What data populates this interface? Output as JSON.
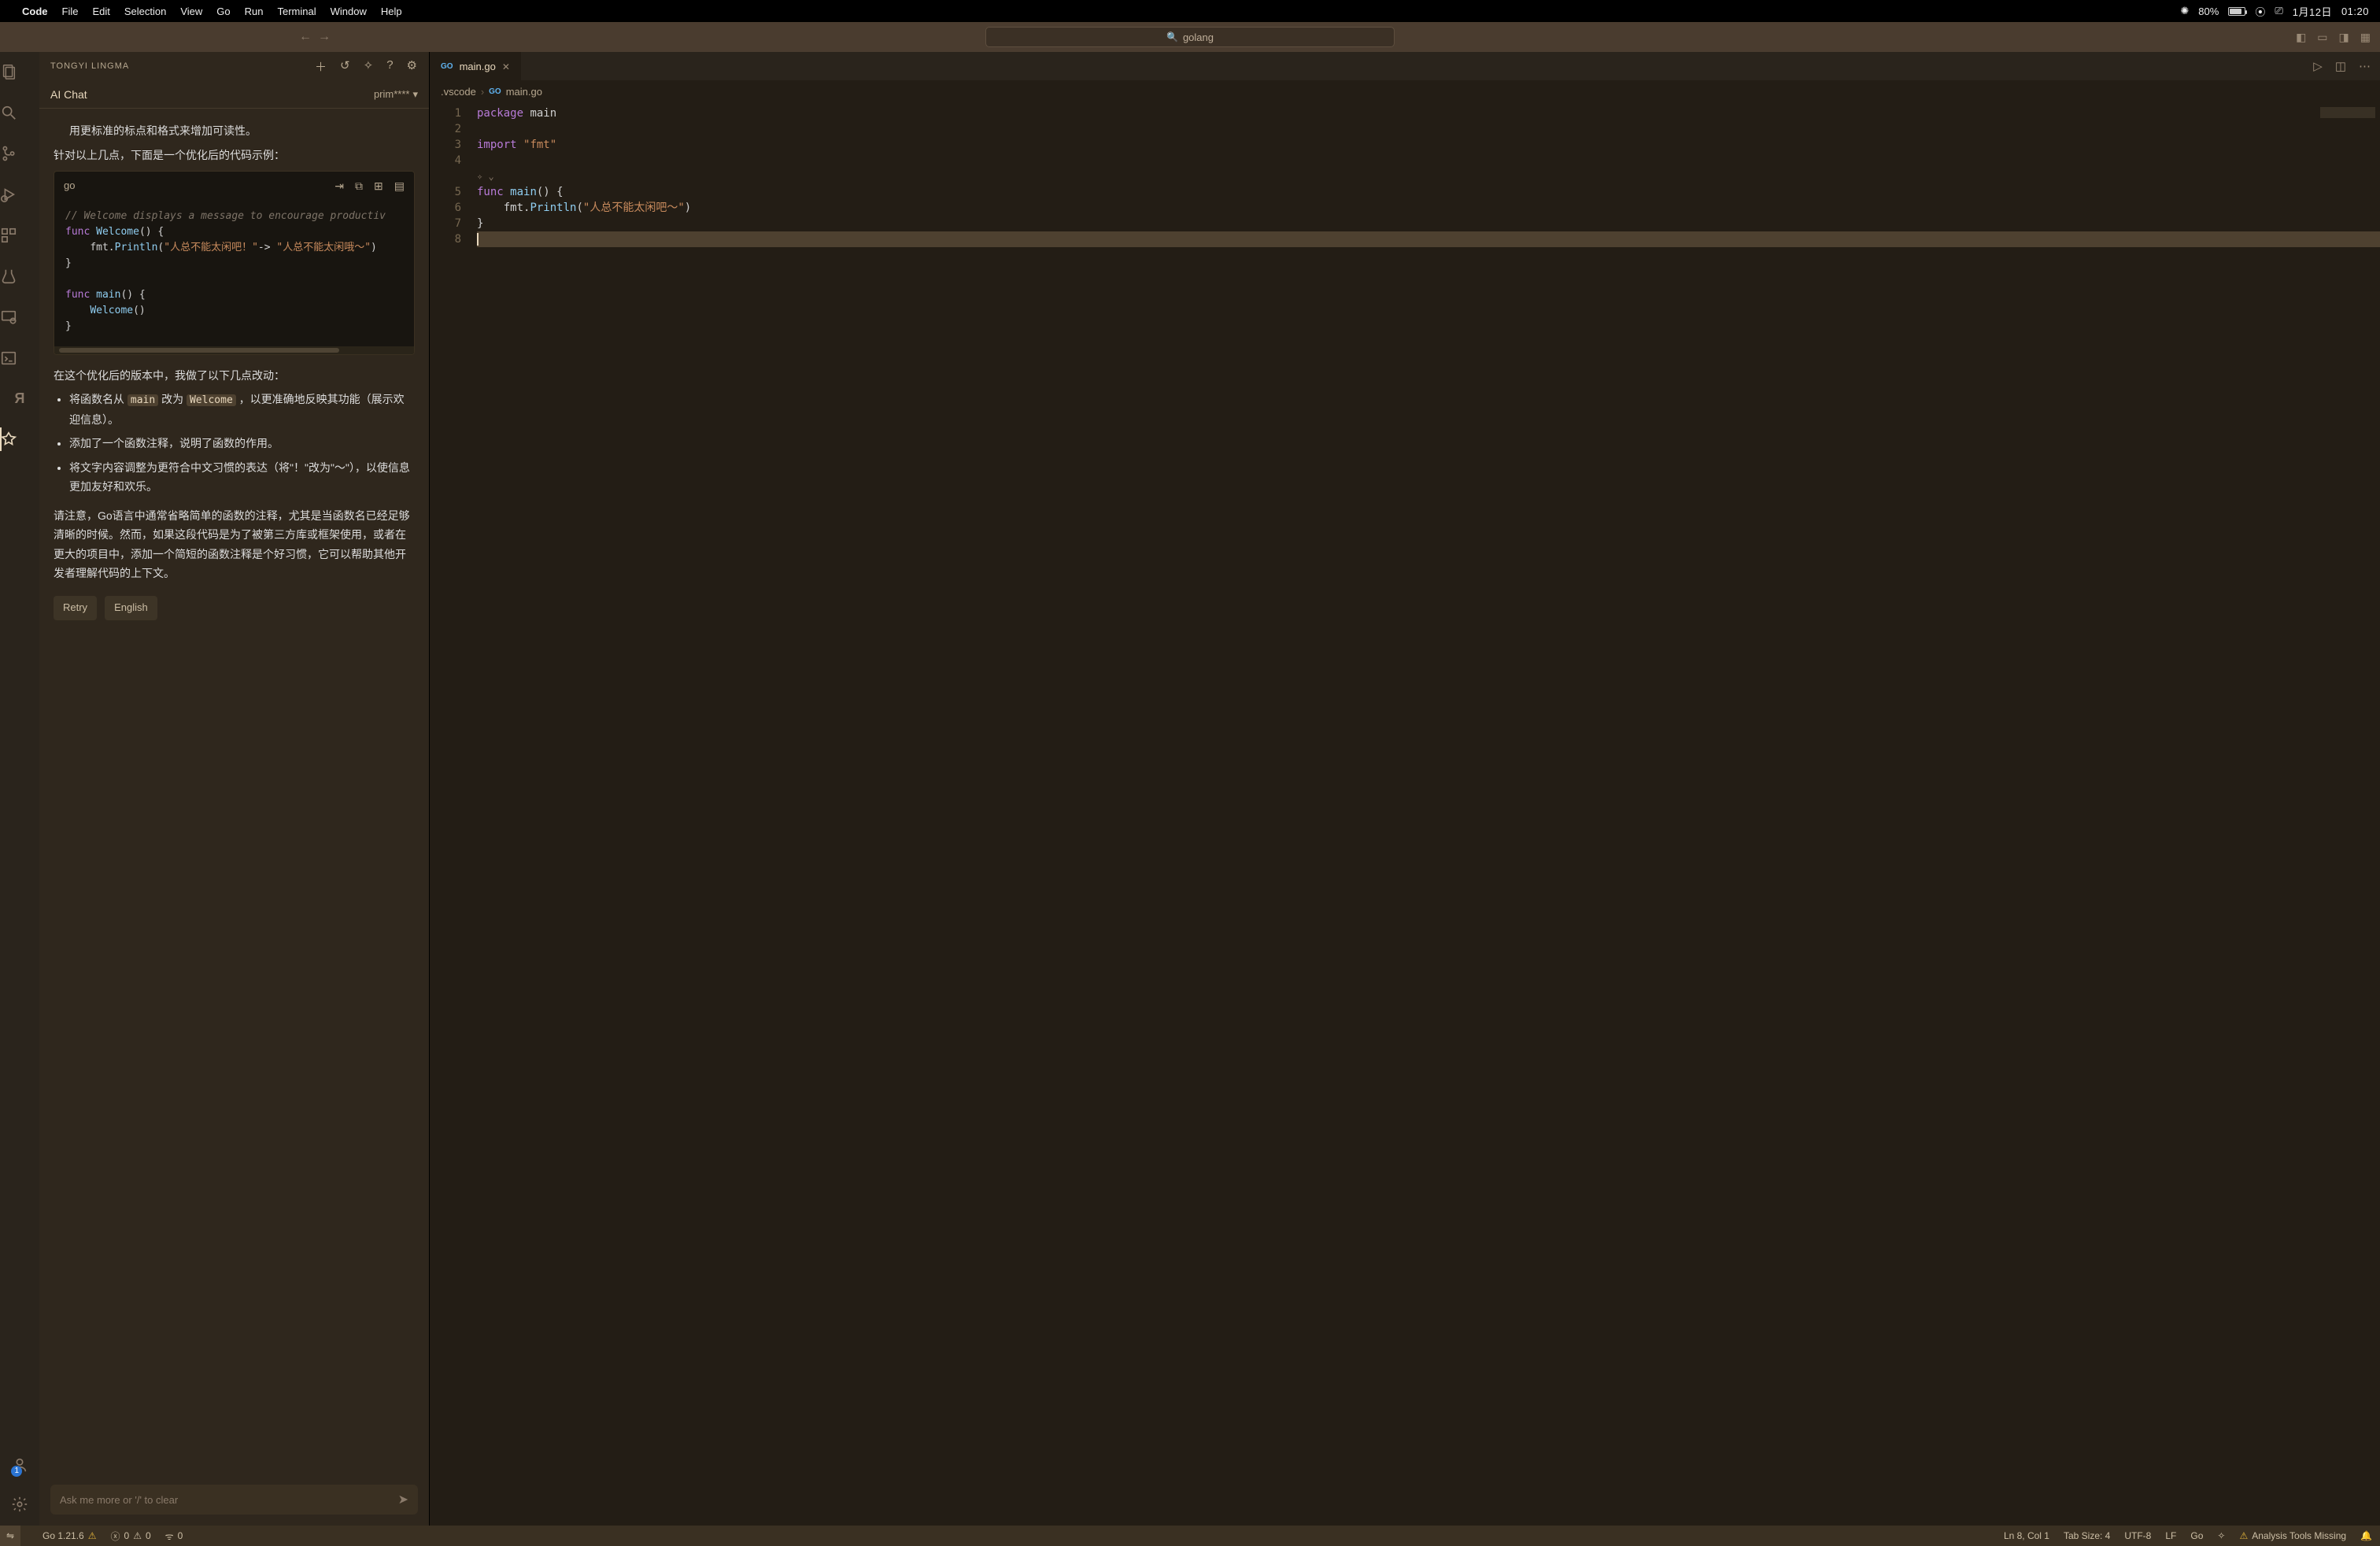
{
  "mac": {
    "app": "Code",
    "menus": [
      "File",
      "Edit",
      "Selection",
      "View",
      "Go",
      "Run",
      "Terminal",
      "Window",
      "Help"
    ],
    "battery_pct": "80%",
    "date": "1月12日",
    "time": "01:20"
  },
  "titlebar": {
    "search_label": "golang"
  },
  "activity": {
    "account_badge": "1"
  },
  "sidebar": {
    "title": "TONGYI LINGMA",
    "subhead": "AI Chat",
    "model": "prim****",
    "chat": {
      "cut_line": "用更标准的标点和格式来增加可读性。",
      "intro": "针对以上几点，下面是一个优化后的代码示例：",
      "code_lang": "go",
      "code_lines": [
        {
          "t": "cm",
          "s": "// Welcome displays a message to encourage productiv"
        },
        {
          "t": "fn",
          "s": "func Welcome() {"
        },
        {
          "t": "pr",
          "s": "    fmt.Println(\"人总不能太闲吧！\"-> \"人总不能太闲哦～\")"
        },
        {
          "t": "pl",
          "s": "}"
        },
        {
          "t": "pl",
          "s": ""
        },
        {
          "t": "fn",
          "s": "func main() {"
        },
        {
          "t": "cl",
          "s": "    Welcome()"
        },
        {
          "t": "pl",
          "s": "}"
        }
      ],
      "after": "在这个优化后的版本中，我做了以下几点改动：",
      "bullets": [
        "将函数名从 <main> 改为 <Welcome> ，以更准确地反映其功能（展示欢迎信息）。",
        "添加了一个函数注释，说明了函数的作用。",
        "将文字内容调整为更符合中文习惯的表达（将\"！\"改为\"～\"），以使信息更加友好和欢乐。"
      ],
      "note": "请注意，Go语言中通常省略简单的函数的注释，尤其是当函数名已经足够清晰的时候。然而，如果这段代码是为了被第三方库或框架使用，或者在更大的项目中，添加一个简短的函数注释是个好习惯，它可以帮助其他开发者理解代码的上下文。",
      "pills": [
        "Retry",
        "English"
      ],
      "input_placeholder": "Ask me more or '/' to clear"
    }
  },
  "editor": {
    "tab_file": "main.go",
    "breadcrumb_root": ".vscode",
    "breadcrumb_file": "main.go",
    "lines": [
      "package main",
      "",
      "import \"fmt\"",
      "",
      "",
      "func main() {",
      "    fmt.Println(\"人总不能太闲吧～\")",
      "}",
      ""
    ],
    "line_count": 8
  },
  "status": {
    "left": {
      "go_version": "Go 1.21.6",
      "errors": "0",
      "warnings": "0",
      "ports": "0"
    },
    "right": {
      "cursor": "Ln 8, Col 1",
      "tabsize": "Tab Size: 4",
      "encoding": "UTF-8",
      "eol": "LF",
      "lang": "Go",
      "analysis": "Analysis Tools Missing"
    }
  }
}
